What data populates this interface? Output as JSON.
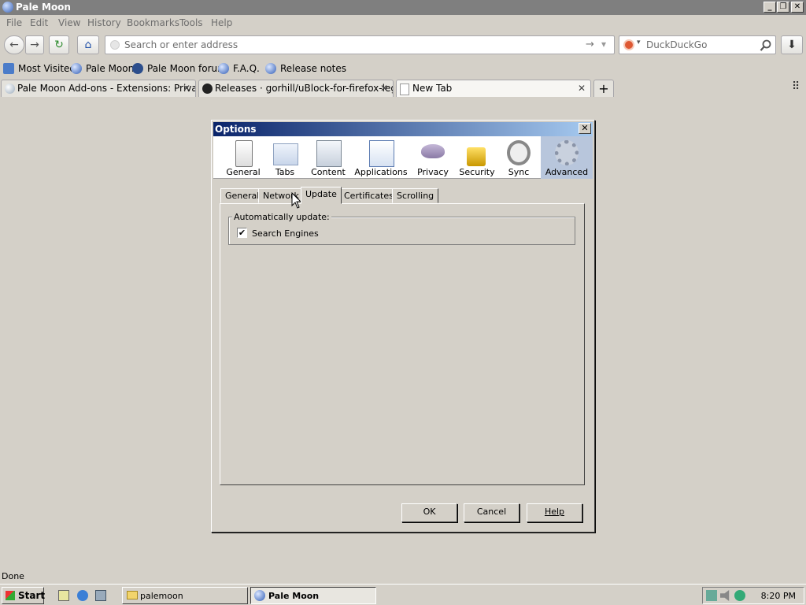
{
  "window": {
    "title": "Pale Moon",
    "minimize": "_",
    "restore": "❐",
    "close": "✕"
  },
  "menu": [
    "File",
    "Edit",
    "View",
    "History",
    "Bookmarks",
    "Tools",
    "Help"
  ],
  "nav": {
    "back": "←",
    "forward": "→",
    "reload": "↻",
    "home": "⌂",
    "address_placeholder": "Search or enter address",
    "go": "→",
    "dropmarker": "▾",
    "search_engine": "DuckDuckGo",
    "search_icon": "magnifier-icon",
    "downloads": "⬇"
  },
  "bookmarks": [
    "Most Visited",
    "Pale Moon",
    "Pale Moon forum",
    "F.A.Q.",
    "Release notes"
  ],
  "tabs": [
    {
      "label": "Pale Moon Add-ons - Extensions: Privacy...",
      "active": false
    },
    {
      "label": "Releases · gorhill/uBlock-for-firefox-legac...",
      "active": false
    },
    {
      "label": "New Tab",
      "active": true
    }
  ],
  "tab_close": "✕",
  "new_tab": "+",
  "list_all_tabs": "⠿",
  "dialog": {
    "title": "Options",
    "close": "✕",
    "panes": [
      "General",
      "Tabs",
      "Content",
      "Applications",
      "Privacy",
      "Security",
      "Sync",
      "Advanced"
    ],
    "selected_pane": "Advanced",
    "subtabs": [
      "General",
      "Network",
      "Update",
      "Certificates",
      "Scrolling"
    ],
    "active_subtab": "Update",
    "group_title": "Automatically update:",
    "checkbox_label": "Search Engines",
    "checkbox_checked": true,
    "checkmark": "✔",
    "buttons": {
      "ok": "OK",
      "cancel": "Cancel",
      "help": "Help"
    }
  },
  "status": "Done",
  "taskbar": {
    "start": "Start",
    "items": [
      "palemoon",
      "Pale Moon"
    ],
    "clock": "8:20 PM"
  }
}
